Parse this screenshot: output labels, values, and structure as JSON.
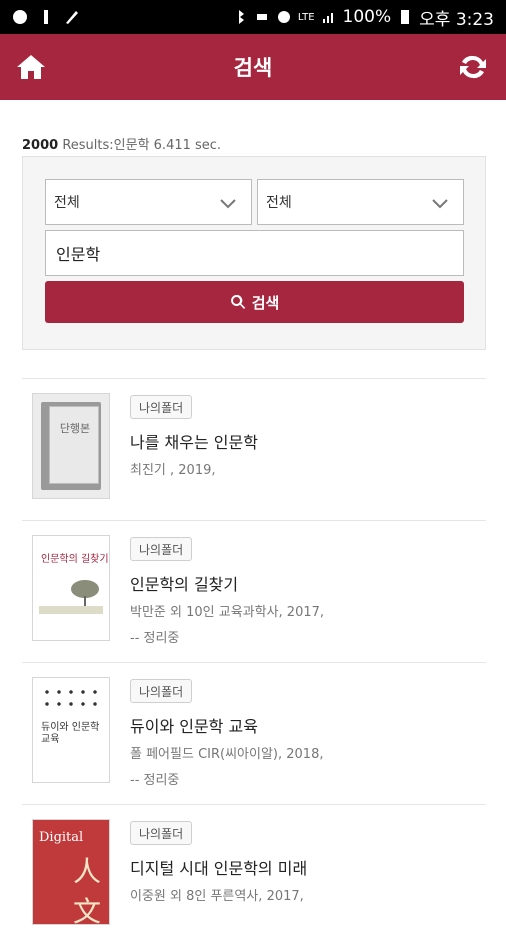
{
  "status": {
    "battery": "100%",
    "time": "오후 3:23",
    "lte": "LTE"
  },
  "header": {
    "title": "검색"
  },
  "results": {
    "count": "2000",
    "text": "Results:인문학 6.411 sec."
  },
  "search": {
    "select1": "전체",
    "select2": "전체",
    "query": "인문학",
    "button_label": "검색"
  },
  "items": [
    {
      "tag": "나의폴더",
      "title": "나를 채우는 인문학",
      "meta": "최진기 , 2019,",
      "meta2": "",
      "cover_label": "단행본"
    },
    {
      "tag": "나의폴더",
      "title": "인문학의 길찾기",
      "meta": "박만준 외 10인 교육과학사, 2017,",
      "meta2": "-- 정리중",
      "cover_label": "인문학의 길찾기"
    },
    {
      "tag": "나의폴더",
      "title": "듀이와 인문학 교육",
      "meta": "폴 페어필드 CIR(씨아이알), 2018,",
      "meta2": "-- 정리중",
      "cover_label": "듀이와 인문학 교육"
    },
    {
      "tag": "나의폴더",
      "title": "디지털 시대 인문학의 미래",
      "meta": "이중원 외 8인 푸른역사, 2017,",
      "meta2": "",
      "cover_label": "Digital",
      "cover_big": "人文"
    }
  ]
}
